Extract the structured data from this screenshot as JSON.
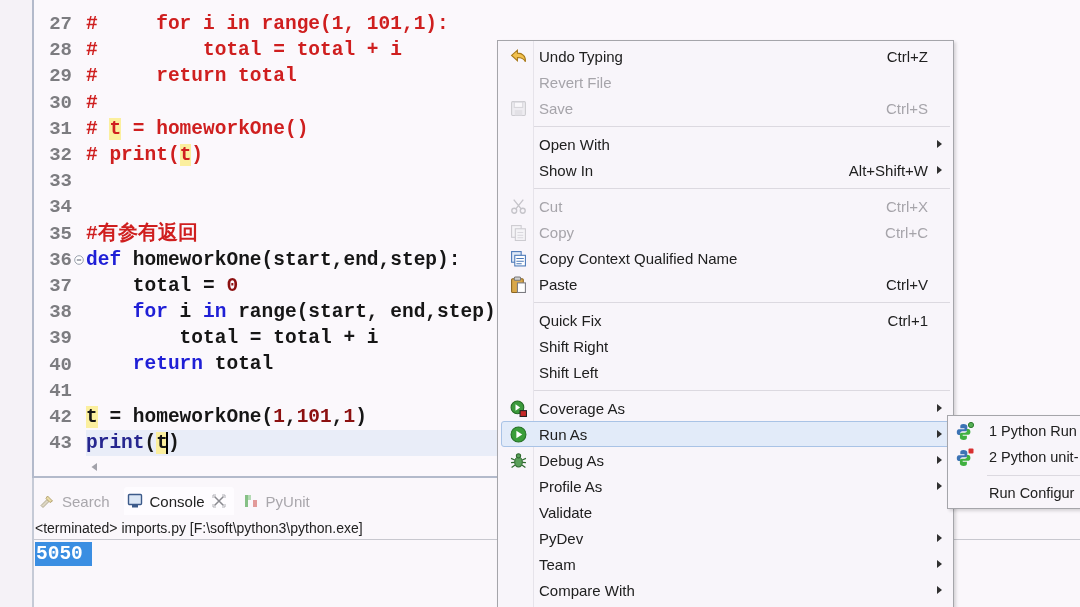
{
  "editor": {
    "lines": [
      {
        "number": "27",
        "fold": false,
        "current": false,
        "tokens": [
          {
            "text": "#     for i in range(1, 101,1):",
            "kind": "comment",
            "highlighted": false,
            "caret": false
          }
        ]
      },
      {
        "number": "28",
        "fold": false,
        "current": false,
        "tokens": [
          {
            "text": "#         total = total + i",
            "kind": "comment",
            "highlighted": false,
            "caret": false
          }
        ]
      },
      {
        "number": "29",
        "fold": false,
        "current": false,
        "tokens": [
          {
            "text": "#     return total",
            "kind": "comment",
            "highlighted": false,
            "caret": false
          }
        ]
      },
      {
        "number": "30",
        "fold": false,
        "current": false,
        "tokens": [
          {
            "text": "#",
            "kind": "comment",
            "highlighted": false,
            "caret": false
          }
        ]
      },
      {
        "number": "31",
        "fold": false,
        "current": false,
        "tokens": [
          {
            "text": "# ",
            "kind": "comment",
            "highlighted": false,
            "caret": false
          },
          {
            "text": "t",
            "kind": "comment",
            "highlighted": true,
            "caret": false
          },
          {
            "text": " = homeworkOne()",
            "kind": "comment",
            "highlighted": false,
            "caret": false
          }
        ]
      },
      {
        "number": "32",
        "fold": false,
        "current": false,
        "tokens": [
          {
            "text": "# print(",
            "kind": "comment",
            "highlighted": false,
            "caret": false
          },
          {
            "text": "t",
            "kind": "comment",
            "highlighted": true,
            "caret": false
          },
          {
            "text": ")",
            "kind": "comment",
            "highlighted": false,
            "caret": false
          }
        ]
      },
      {
        "number": "33",
        "fold": false,
        "current": false
      },
      {
        "number": "34",
        "fold": false,
        "current": false
      },
      {
        "number": "35",
        "fold": false,
        "current": false,
        "tokens": [
          {
            "text": "#有参有返回",
            "kind": "comment",
            "highlighted": false,
            "caret": false
          }
        ]
      },
      {
        "number": "36",
        "fold": true,
        "current": false,
        "tokens": [
          {
            "text": "def",
            "kind": "keyword",
            "highlighted": false,
            "caret": false
          },
          {
            "text": " homeworkOne(start,end,step):",
            "kind": "plain",
            "highlighted": false,
            "caret": false
          }
        ]
      },
      {
        "number": "37",
        "fold": false,
        "current": false,
        "tokens": [
          {
            "text": "    total = ",
            "kind": "plain",
            "highlighted": false,
            "caret": false
          },
          {
            "text": "0",
            "kind": "number",
            "highlighted": false,
            "caret": false
          }
        ]
      },
      {
        "number": "38",
        "fold": false,
        "current": false,
        "tokens": [
          {
            "text": "    for",
            "kind": "keyword",
            "highlighted": false,
            "caret": false
          },
          {
            "text": " i ",
            "kind": "plain",
            "highlighted": false,
            "caret": false
          },
          {
            "text": "in",
            "kind": "keyword",
            "highlighted": false,
            "caret": false
          },
          {
            "text": " range(start, end,step)",
            "kind": "plain",
            "highlighted": false,
            "caret": false
          }
        ]
      },
      {
        "number": "39",
        "fold": false,
        "current": false,
        "tokens": [
          {
            "text": "        total = total + i",
            "kind": "plain",
            "highlighted": false,
            "caret": false
          }
        ]
      },
      {
        "number": "40",
        "fold": false,
        "current": false,
        "tokens": [
          {
            "text": "    return",
            "kind": "keyword",
            "highlighted": false,
            "caret": false
          },
          {
            "text": " total",
            "kind": "plain",
            "highlighted": false,
            "caret": false
          }
        ]
      },
      {
        "number": "41",
        "fold": false,
        "current": false
      },
      {
        "number": "42",
        "fold": false,
        "current": false,
        "tokens": [
          {
            "text": "t",
            "kind": "plain",
            "highlighted": true,
            "caret": false
          },
          {
            "text": " = homeworkOne(",
            "kind": "plain",
            "highlighted": false,
            "caret": false
          },
          {
            "text": "1",
            "kind": "number",
            "highlighted": false,
            "caret": false
          },
          {
            "text": ",",
            "kind": "plain",
            "highlighted": false,
            "caret": false
          },
          {
            "text": "101",
            "kind": "number",
            "highlighted": false,
            "caret": false
          },
          {
            "text": ",",
            "kind": "plain",
            "highlighted": false,
            "caret": false
          },
          {
            "text": "1",
            "kind": "number",
            "highlighted": false,
            "caret": false
          },
          {
            "text": ")",
            "kind": "plain",
            "highlighted": false,
            "caret": false
          }
        ]
      },
      {
        "number": "43",
        "fold": false,
        "current": true,
        "tokens": [
          {
            "text": "print",
            "kind": "builtin",
            "highlighted": false,
            "caret": false
          },
          {
            "text": "(",
            "kind": "plain",
            "highlighted": false,
            "caret": false
          },
          {
            "text": "t",
            "kind": "plain",
            "highlighted": true,
            "caret": true
          },
          {
            "text": ")",
            "kind": "plain",
            "highlighted": false,
            "caret": false
          }
        ]
      }
    ]
  },
  "console": {
    "tabs": [
      {
        "label": "Search",
        "selected": false,
        "closable": false
      },
      {
        "label": "Console",
        "selected": true,
        "closable": true
      },
      {
        "label": "PyUnit",
        "selected": false,
        "closable": false
      }
    ],
    "status": "<terminated> imports.py [F:\\soft\\python3\\python.exe]",
    "output": {
      "text": "5050",
      "selected": true
    }
  },
  "context_menu": {
    "groups": [
      {
        "items": [
          {
            "label": "Undo Typing",
            "shortcut": "Ctrl+Z",
            "disabled": false,
            "submenu": false,
            "selected": false
          },
          {
            "label": "Revert File",
            "disabled": true,
            "submenu": false,
            "selected": false
          },
          {
            "label": "Save",
            "shortcut": "Ctrl+S",
            "disabled": true,
            "submenu": false,
            "selected": false
          }
        ]
      },
      {
        "items": [
          {
            "label": "Open With",
            "disabled": false,
            "submenu": true,
            "selected": false
          },
          {
            "label": "Show In",
            "shortcut": "Alt+Shift+W",
            "disabled": false,
            "submenu": true,
            "selected": false
          }
        ]
      },
      {
        "items": [
          {
            "label": "Cut",
            "shortcut": "Ctrl+X",
            "disabled": true,
            "submenu": false,
            "selected": false
          },
          {
            "label": "Copy",
            "shortcut": "Ctrl+C",
            "disabled": true,
            "submenu": false,
            "selected": false
          },
          {
            "label": "Copy Context Qualified Name",
            "disabled": false,
            "submenu": false,
            "selected": false
          },
          {
            "label": "Paste",
            "shortcut": "Ctrl+V",
            "disabled": false,
            "submenu": false,
            "selected": false
          }
        ]
      },
      {
        "items": [
          {
            "label": "Quick Fix",
            "shortcut": "Ctrl+1",
            "disabled": false,
            "submenu": false,
            "selected": false
          },
          {
            "label": "Shift Right",
            "disabled": false,
            "submenu": false,
            "selected": false
          },
          {
            "label": "Shift Left",
            "disabled": false,
            "submenu": false,
            "selected": false
          }
        ]
      },
      {
        "items": [
          {
            "label": "Coverage As",
            "disabled": false,
            "submenu": true,
            "selected": false
          },
          {
            "label": "Run As",
            "disabled": false,
            "submenu": true,
            "selected": true
          },
          {
            "label": "Debug As",
            "disabled": false,
            "submenu": true,
            "selected": false
          },
          {
            "label": "Profile As",
            "disabled": false,
            "submenu": true,
            "selected": false
          },
          {
            "label": "Validate",
            "disabled": false,
            "submenu": false,
            "selected": false
          },
          {
            "label": "PyDev",
            "disabled": false,
            "submenu": true,
            "selected": false
          },
          {
            "label": "Team",
            "disabled": false,
            "submenu": true,
            "selected": false
          },
          {
            "label": "Compare With",
            "disabled": false,
            "submenu": true,
            "selected": false
          }
        ]
      }
    ]
  },
  "run_as_submenu": {
    "groups": [
      {
        "items": [
          {
            "label": "1 Python Run",
            "selected": false
          },
          {
            "label": "2 Python unit-",
            "selected": false
          }
        ]
      },
      {
        "items": [
          {
            "label": "Run Configur",
            "selected": false
          }
        ]
      }
    ]
  }
}
